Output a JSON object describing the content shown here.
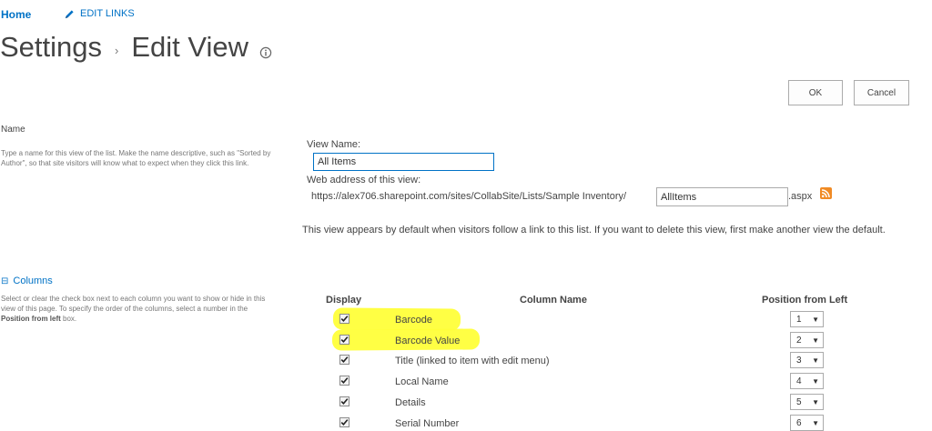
{
  "nav": {
    "home": "Home",
    "edit_links": "EDIT LINKS"
  },
  "title": {
    "part1": "Settings",
    "separator": "›",
    "part2": "Edit View"
  },
  "buttons": {
    "ok": "OK",
    "cancel": "Cancel"
  },
  "name_section": {
    "heading": "Name",
    "description": "Type a name for this view of the list. Make the name descriptive, such as \"Sorted by Author\", so that site visitors will know what to expect when they click this link.",
    "view_name_label": "View Name:",
    "view_name_value": "All Items",
    "web_address_label": "Web address of this view:",
    "url_prefix": "https://alex706.sharepoint.com/sites/CollabSite/Lists/Sample Inventory/",
    "url_value": "AllItems",
    "url_suffix": ".aspx",
    "default_note": "This view appears by default when visitors follow a link to this list. If you want to delete this view, first make another view the default."
  },
  "columns_section": {
    "heading": "Columns",
    "toggle": "⊟",
    "description_pre": "Select or clear the check box next to each column you want to show or hide in this view of this page. To specify the order of the columns, select a number in the ",
    "description_bold": "Position from left",
    "description_post": " box.",
    "headers": {
      "display": "Display",
      "column_name": "Column Name",
      "position": "Position from Left"
    },
    "rows": [
      {
        "checked": true,
        "name": "Barcode",
        "position": "1"
      },
      {
        "checked": true,
        "name": "Barcode Value",
        "position": "2"
      },
      {
        "checked": true,
        "name": "Title (linked to item with edit menu)",
        "position": "3"
      },
      {
        "checked": true,
        "name": "Local Name",
        "position": "4"
      },
      {
        "checked": true,
        "name": "Details",
        "position": "5"
      },
      {
        "checked": true,
        "name": "Serial Number",
        "position": "6"
      }
    ]
  },
  "colors": {
    "accent": "#0072c6",
    "highlight": "#ffff3a",
    "rss": "#f08a24"
  }
}
